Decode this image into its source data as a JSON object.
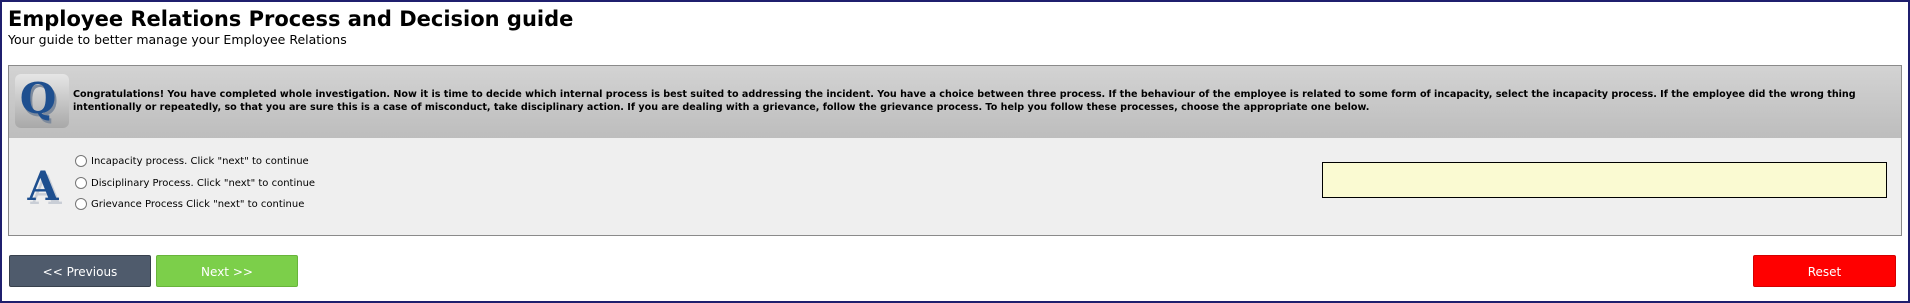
{
  "header": {
    "title": "Employee Relations Process and Decision guide",
    "subtitle": "Your guide to better manage your Employee Relations"
  },
  "question": {
    "icon": "q-letter-icon",
    "text": "Congratulations! You have completed whole investigation. Now it is time to decide which internal process is best suited to addressing the incident. You have a choice between three process. If the behaviour of the employee is related to some form of incapacity, select the incapacity process. If the employee did the wrong thing intentionally or repeatedly, so that you are sure this is a case of misconduct, take disciplinary action. If you are dealing with a grievance, follow the grievance process. To help you follow these processes, choose the appropriate one below."
  },
  "answer": {
    "icon": "a-letter-icon",
    "options": [
      {
        "label": "Incapacity process. Click \"next\" to continue",
        "selected": false
      },
      {
        "label": "Disciplinary Process. Click \"next\" to continue",
        "selected": false
      },
      {
        "label": "Grievance Process Click \"next\" to continue",
        "selected": false
      }
    ],
    "feedback": ""
  },
  "nav": {
    "previous_label": "<< Previous",
    "next_label": "Next >>",
    "reset_label": "Reset"
  },
  "colors": {
    "previous_button": "#4f5b6c",
    "next_button": "#7ccf4a",
    "reset_button": "#ff0000",
    "feedback_box": "#fafad2",
    "frame_border": "#1f1f6e"
  }
}
